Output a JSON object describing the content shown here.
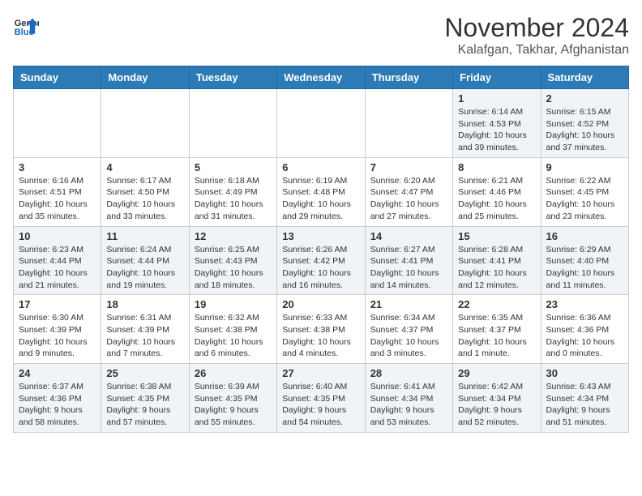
{
  "header": {
    "logo_line1": "General",
    "logo_line2": "Blue",
    "month": "November 2024",
    "location": "Kalafgan, Takhar, Afghanistan"
  },
  "weekdays": [
    "Sunday",
    "Monday",
    "Tuesday",
    "Wednesday",
    "Thursday",
    "Friday",
    "Saturday"
  ],
  "weeks": [
    [
      {
        "day": "",
        "info": ""
      },
      {
        "day": "",
        "info": ""
      },
      {
        "day": "",
        "info": ""
      },
      {
        "day": "",
        "info": ""
      },
      {
        "day": "",
        "info": ""
      },
      {
        "day": "1",
        "info": "Sunrise: 6:14 AM\nSunset: 4:53 PM\nDaylight: 10 hours and 39 minutes."
      },
      {
        "day": "2",
        "info": "Sunrise: 6:15 AM\nSunset: 4:52 PM\nDaylight: 10 hours and 37 minutes."
      }
    ],
    [
      {
        "day": "3",
        "info": "Sunrise: 6:16 AM\nSunset: 4:51 PM\nDaylight: 10 hours and 35 minutes."
      },
      {
        "day": "4",
        "info": "Sunrise: 6:17 AM\nSunset: 4:50 PM\nDaylight: 10 hours and 33 minutes."
      },
      {
        "day": "5",
        "info": "Sunrise: 6:18 AM\nSunset: 4:49 PM\nDaylight: 10 hours and 31 minutes."
      },
      {
        "day": "6",
        "info": "Sunrise: 6:19 AM\nSunset: 4:48 PM\nDaylight: 10 hours and 29 minutes."
      },
      {
        "day": "7",
        "info": "Sunrise: 6:20 AM\nSunset: 4:47 PM\nDaylight: 10 hours and 27 minutes."
      },
      {
        "day": "8",
        "info": "Sunrise: 6:21 AM\nSunset: 4:46 PM\nDaylight: 10 hours and 25 minutes."
      },
      {
        "day": "9",
        "info": "Sunrise: 6:22 AM\nSunset: 4:45 PM\nDaylight: 10 hours and 23 minutes."
      }
    ],
    [
      {
        "day": "10",
        "info": "Sunrise: 6:23 AM\nSunset: 4:44 PM\nDaylight: 10 hours and 21 minutes."
      },
      {
        "day": "11",
        "info": "Sunrise: 6:24 AM\nSunset: 4:44 PM\nDaylight: 10 hours and 19 minutes."
      },
      {
        "day": "12",
        "info": "Sunrise: 6:25 AM\nSunset: 4:43 PM\nDaylight: 10 hours and 18 minutes."
      },
      {
        "day": "13",
        "info": "Sunrise: 6:26 AM\nSunset: 4:42 PM\nDaylight: 10 hours and 16 minutes."
      },
      {
        "day": "14",
        "info": "Sunrise: 6:27 AM\nSunset: 4:41 PM\nDaylight: 10 hours and 14 minutes."
      },
      {
        "day": "15",
        "info": "Sunrise: 6:28 AM\nSunset: 4:41 PM\nDaylight: 10 hours and 12 minutes."
      },
      {
        "day": "16",
        "info": "Sunrise: 6:29 AM\nSunset: 4:40 PM\nDaylight: 10 hours and 11 minutes."
      }
    ],
    [
      {
        "day": "17",
        "info": "Sunrise: 6:30 AM\nSunset: 4:39 PM\nDaylight: 10 hours and 9 minutes."
      },
      {
        "day": "18",
        "info": "Sunrise: 6:31 AM\nSunset: 4:39 PM\nDaylight: 10 hours and 7 minutes."
      },
      {
        "day": "19",
        "info": "Sunrise: 6:32 AM\nSunset: 4:38 PM\nDaylight: 10 hours and 6 minutes."
      },
      {
        "day": "20",
        "info": "Sunrise: 6:33 AM\nSunset: 4:38 PM\nDaylight: 10 hours and 4 minutes."
      },
      {
        "day": "21",
        "info": "Sunrise: 6:34 AM\nSunset: 4:37 PM\nDaylight: 10 hours and 3 minutes."
      },
      {
        "day": "22",
        "info": "Sunrise: 6:35 AM\nSunset: 4:37 PM\nDaylight: 10 hours and 1 minute."
      },
      {
        "day": "23",
        "info": "Sunrise: 6:36 AM\nSunset: 4:36 PM\nDaylight: 10 hours and 0 minutes."
      }
    ],
    [
      {
        "day": "24",
        "info": "Sunrise: 6:37 AM\nSunset: 4:36 PM\nDaylight: 9 hours and 58 minutes."
      },
      {
        "day": "25",
        "info": "Sunrise: 6:38 AM\nSunset: 4:35 PM\nDaylight: 9 hours and 57 minutes."
      },
      {
        "day": "26",
        "info": "Sunrise: 6:39 AM\nSunset: 4:35 PM\nDaylight: 9 hours and 55 minutes."
      },
      {
        "day": "27",
        "info": "Sunrise: 6:40 AM\nSunset: 4:35 PM\nDaylight: 9 hours and 54 minutes."
      },
      {
        "day": "28",
        "info": "Sunrise: 6:41 AM\nSunset: 4:34 PM\nDaylight: 9 hours and 53 minutes."
      },
      {
        "day": "29",
        "info": "Sunrise: 6:42 AM\nSunset: 4:34 PM\nDaylight: 9 hours and 52 minutes."
      },
      {
        "day": "30",
        "info": "Sunrise: 6:43 AM\nSunset: 4:34 PM\nDaylight: 9 hours and 51 minutes."
      }
    ]
  ]
}
